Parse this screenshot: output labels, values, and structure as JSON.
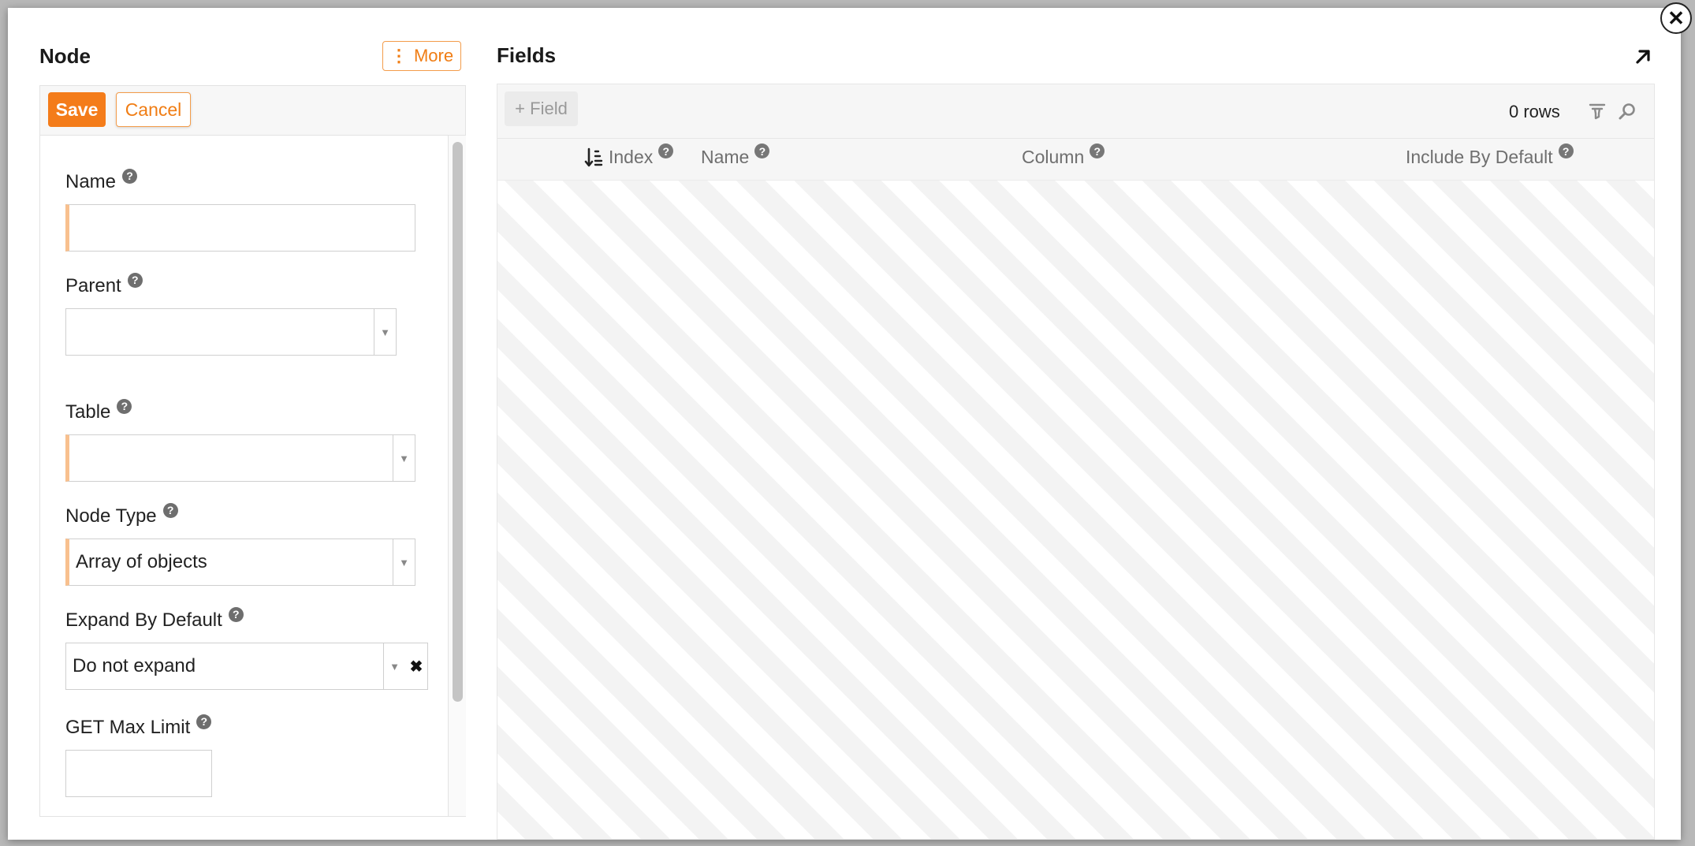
{
  "left": {
    "title": "Node",
    "more_label": "More",
    "save_label": "Save",
    "cancel_label": "Cancel",
    "fields": {
      "name": {
        "label": "Name",
        "value": ""
      },
      "parent": {
        "label": "Parent",
        "value": ""
      },
      "table": {
        "label": "Table",
        "value": ""
      },
      "node_type": {
        "label": "Node Type",
        "value": "Array of objects"
      },
      "expand_by_default": {
        "label": "Expand By Default",
        "value": "Do not expand"
      },
      "get_max_limit": {
        "label": "GET Max Limit",
        "value": ""
      }
    }
  },
  "right": {
    "title": "Fields",
    "add_field_label": "+ Field",
    "row_count": "0 rows",
    "columns": [
      "Index",
      "Name",
      "Column",
      "Include By Default"
    ]
  },
  "icons": {
    "close": "close-icon",
    "expand": "expand-arrow-icon",
    "filter": "filter-icon",
    "search": "search-icon",
    "sort": "sort-descending-icon",
    "help": "help-icon"
  },
  "colors": {
    "accent": "#f47c1a",
    "required_marker": "#f8c08e"
  }
}
